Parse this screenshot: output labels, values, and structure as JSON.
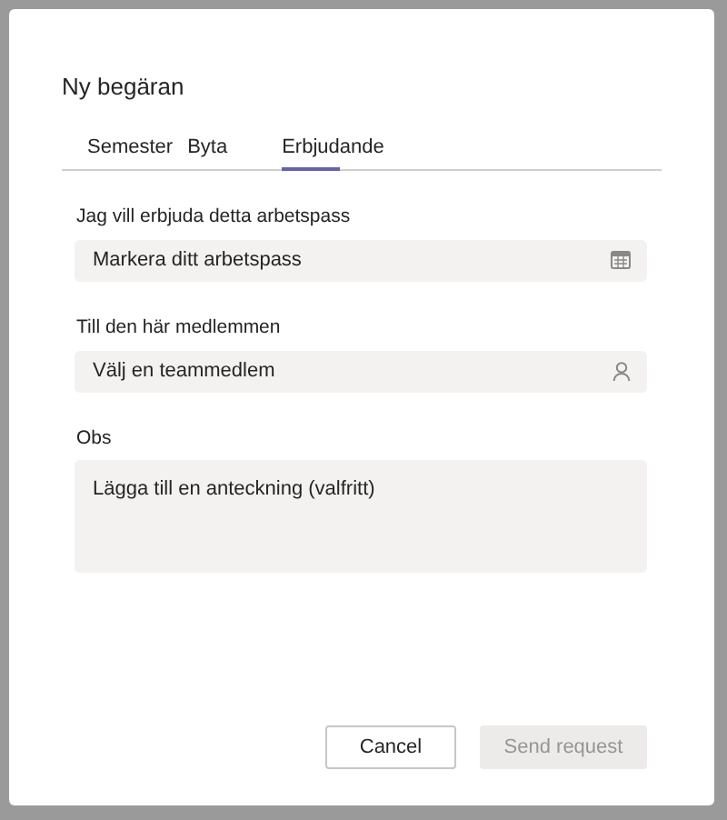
{
  "dialog": {
    "title": "Ny begäran"
  },
  "tabs": [
    {
      "label": "Semester",
      "selected": false
    },
    {
      "label": "Byta",
      "selected": false
    },
    {
      "label": "Erbjudande",
      "selected": true
    }
  ],
  "fields": [
    {
      "label": "Jag vill erbjuda detta arbetspass",
      "placeholder": "Markera ditt arbetspass",
      "kind": "date"
    },
    {
      "label": "Till den här medlemmen",
      "placeholder": "Välj en teammedlem",
      "kind": "person"
    },
    {
      "label": "Obs",
      "placeholder": "Lägga till en anteckning (valfritt)",
      "kind": "note"
    }
  ],
  "buttons": [
    {
      "label": "Cancel",
      "disabled": false
    },
    {
      "label": "Send request",
      "disabled": true
    }
  ]
}
